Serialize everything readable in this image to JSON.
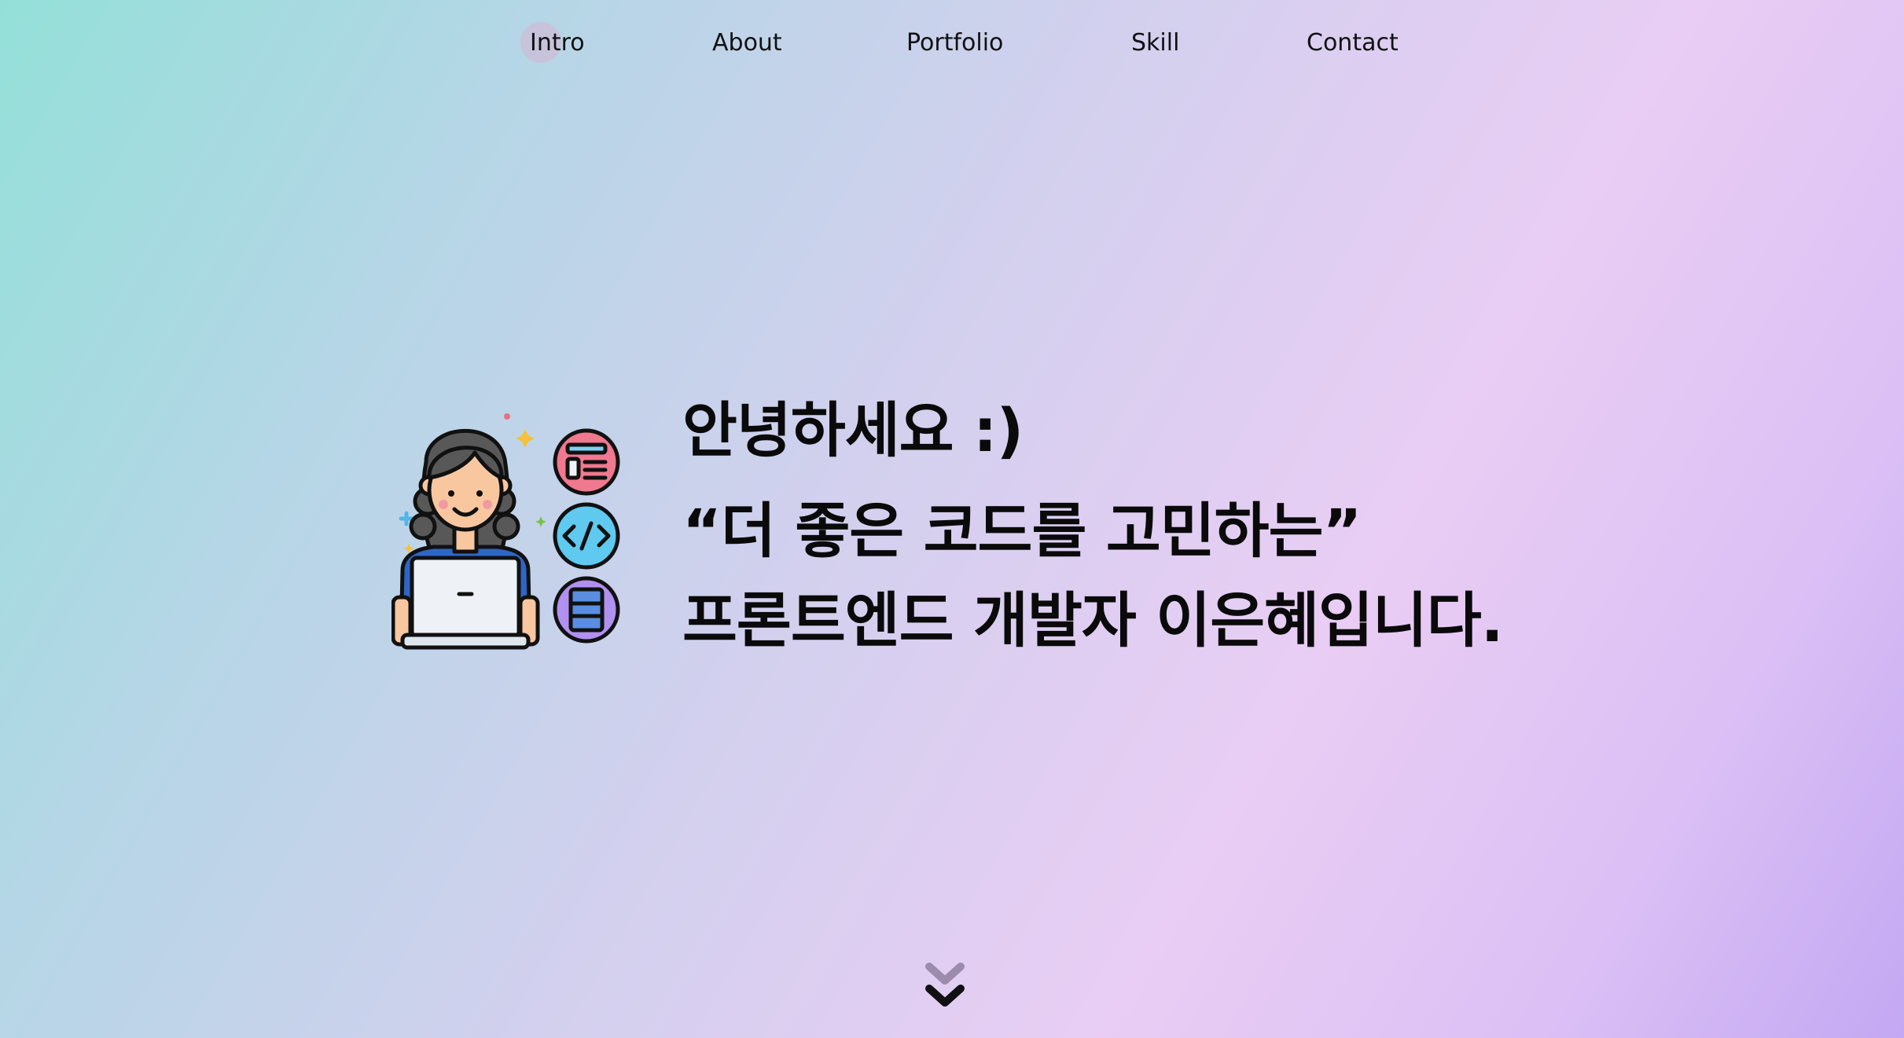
{
  "nav": {
    "items": [
      {
        "label": "Intro",
        "active": true
      },
      {
        "label": "About"
      },
      {
        "label": "Portfolio"
      },
      {
        "label": "Skill"
      },
      {
        "label": "Contact"
      }
    ]
  },
  "hero": {
    "greeting": "안녕하세요 :)",
    "tagline": "“더 좋은 코드를 고민하는”",
    "intro": "프론트엔드 개발자 이은혜입니다.",
    "illustration": {
      "icons": [
        "developer-woman-laptop-icon",
        "layout-icon",
        "code-icon",
        "database-icon"
      ]
    }
  },
  "scroll": {
    "icon": "chevron-double-down-icon"
  },
  "colors": {
    "background_start": "#94e0d9",
    "background_end": "#c3a8f3",
    "nav_active_dot": "#e8a0c4",
    "text": "#0a0a0a"
  }
}
